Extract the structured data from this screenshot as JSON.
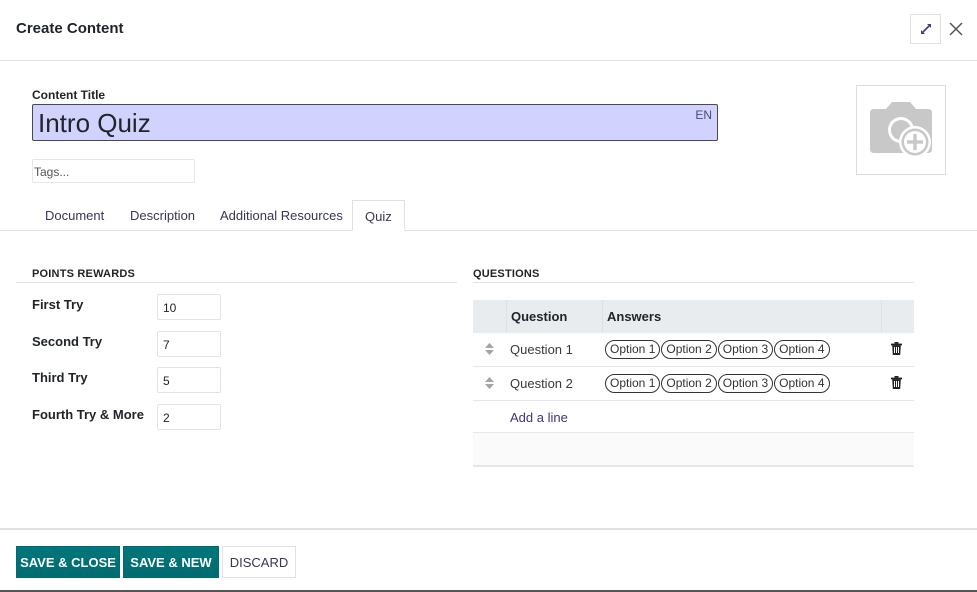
{
  "dialog": {
    "title": "Create Content",
    "expand_icon": "expand-arrows-icon",
    "close_icon": "close-x-icon"
  },
  "form": {
    "title_label": "Content Title",
    "title_value": "Intro Quiz",
    "title_lang": "EN",
    "tags_placeholder": "Tags...",
    "image_icon": "camera-plus-icon"
  },
  "tabs": [
    {
      "label": "Document",
      "active": false
    },
    {
      "label": "Description",
      "active": false
    },
    {
      "label": "Additional Resources",
      "active": false
    },
    {
      "label": "Quiz",
      "active": true
    }
  ],
  "points_rewards": {
    "title": "POINTS REWARDS",
    "rows": [
      {
        "label": "First Try",
        "value": "10"
      },
      {
        "label": "Second Try",
        "value": "7"
      },
      {
        "label": "Third Try",
        "value": "5"
      },
      {
        "label": "Fourth Try & More",
        "value": "2"
      }
    ]
  },
  "questions": {
    "title": "QUESTIONS",
    "columns": [
      "Question",
      "Answers"
    ],
    "rows": [
      {
        "question": "Question 1",
        "answers": [
          "Option 1",
          "Option 2",
          "Option 3",
          "Option 4"
        ]
      },
      {
        "question": "Question 2",
        "answers": [
          "Option 1",
          "Option 2",
          "Option 3",
          "Option 4"
        ]
      }
    ],
    "add_line": "Add a line"
  },
  "footer": {
    "save_close": "SAVE & CLOSE",
    "save_new": "SAVE & NEW",
    "discard": "DISCARD"
  },
  "colors": {
    "primary": "#017e84",
    "title_input_bg": "#d2d2ff"
  }
}
